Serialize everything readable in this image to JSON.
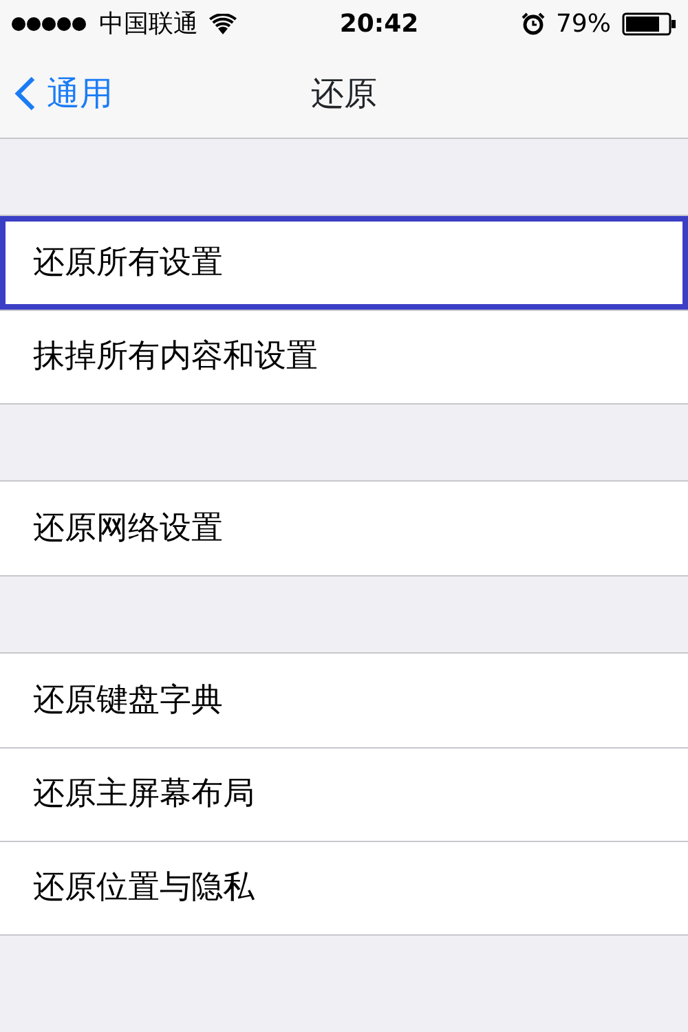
{
  "status_bar": {
    "carrier": "中国联通",
    "time": "20:42",
    "battery": "79%"
  },
  "nav_bar": {
    "back": "通用",
    "title": "还原"
  },
  "groups": [
    {
      "items": [
        {
          "label": "还原所有设置",
          "highlighted": true
        },
        {
          "label": "抹掉所有内容和设置",
          "highlighted": false
        }
      ]
    },
    {
      "items": [
        {
          "label": "还原网络设置",
          "highlighted": false
        }
      ]
    },
    {
      "items": [
        {
          "label": "还原键盘字典",
          "highlighted": false
        },
        {
          "label": "还原主屏幕布局",
          "highlighted": false
        },
        {
          "label": "还原位置与隐私",
          "highlighted": false
        }
      ]
    }
  ]
}
